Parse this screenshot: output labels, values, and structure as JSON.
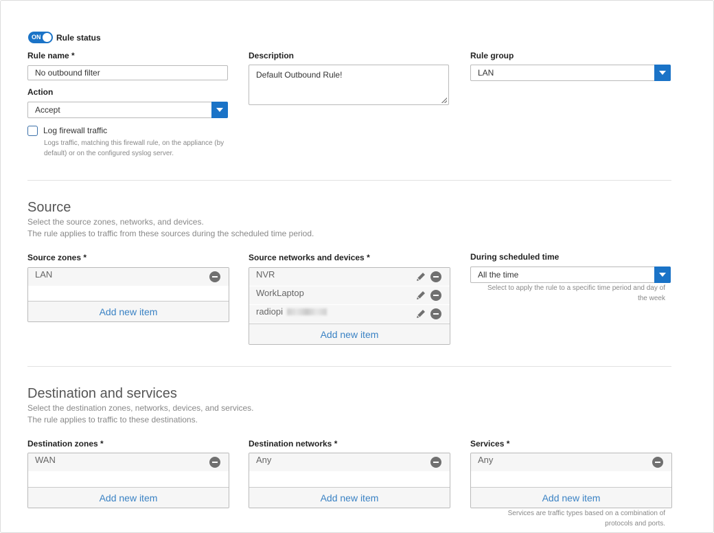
{
  "rule_status": {
    "toggle_text": "ON",
    "label": "Rule status"
  },
  "rule_name": {
    "label": "Rule name *",
    "value": "No outbound filter"
  },
  "action": {
    "label": "Action",
    "value": "Accept"
  },
  "log_traffic": {
    "label": "Log firewall traffic",
    "help": "Logs traffic, matching this firewall rule, on the appliance (by default) or on the configured syslog server.",
    "checked": false
  },
  "description": {
    "label": "Description",
    "value": "Default Outbound Rule!"
  },
  "rule_group": {
    "label": "Rule group",
    "value": "LAN"
  },
  "source": {
    "title": "Source",
    "sub1": "Select the source zones, networks, and devices.",
    "sub2": "The rule applies to traffic from these sources during the scheduled time period.",
    "zones_label": "Source zones *",
    "zones": [
      "LAN"
    ],
    "networks_label": "Source networks and devices *",
    "networks": [
      "NVR",
      "WorkLaptop",
      "radiopi"
    ],
    "schedule_label": "During scheduled time",
    "schedule_value": "All the time",
    "schedule_help": "Select to apply the rule to a specific time period and day of the week"
  },
  "destination": {
    "title": "Destination and services",
    "sub1": "Select the destination zones, networks, devices, and services.",
    "sub2": "The rule applies to traffic to these destinations.",
    "zones_label": "Destination zones *",
    "zones": [
      "WAN"
    ],
    "networks_label": "Destination networks *",
    "networks": [
      "Any"
    ],
    "services_label": "Services *",
    "services": [
      "Any"
    ],
    "services_help": "Services are traffic types based on a combination of protocols and ports."
  },
  "add_item_label": "Add new item",
  "colors": {
    "accent": "#1a73c7",
    "link": "#3a82c4"
  }
}
